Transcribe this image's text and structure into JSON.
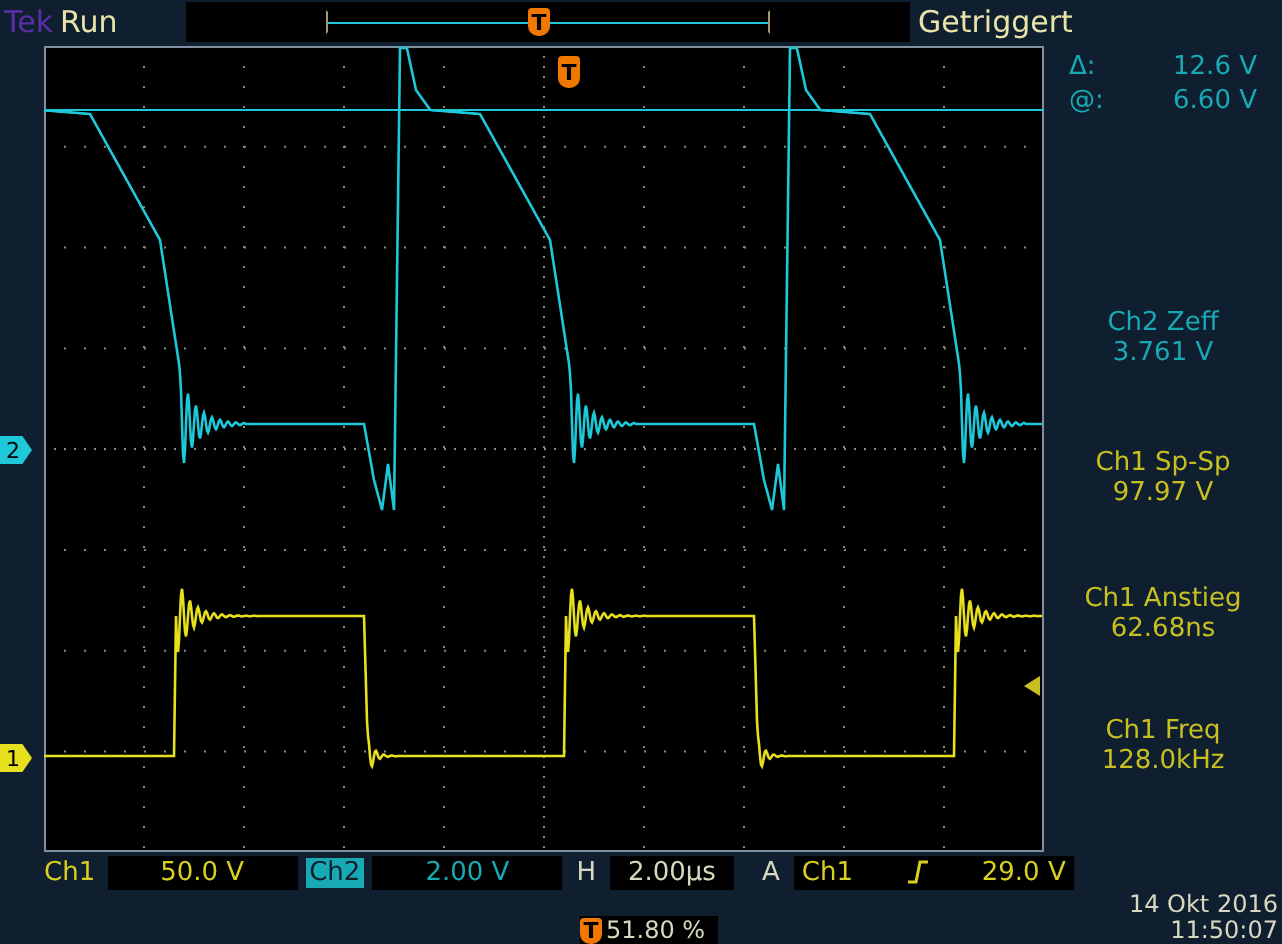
{
  "header": {
    "brand": "Tek",
    "acquisition": "Run",
    "trigger_status": "Getriggert",
    "trigger_position_marker": "T"
  },
  "cursor_readouts": [
    {
      "label": "Δ:",
      "value": "12.6 V"
    },
    {
      "label": "@:",
      "value": "6.60 V"
    }
  ],
  "display": {
    "trigger_marker": "T",
    "channel_markers": [
      {
        "label": "2",
        "color": "#1ec8d8"
      },
      {
        "label": "1",
        "color": "#e6e01e"
      }
    ]
  },
  "measurements": [
    {
      "name": "Ch2 Zeff",
      "value": "3.761 V",
      "color": "#18aab4"
    },
    {
      "name": "Ch1 Sp-Sp",
      "value": "97.97 V",
      "color": "#c8c020"
    },
    {
      "name": "Ch1 Anstieg",
      "value": "62.68ns",
      "color": "#c8c020"
    },
    {
      "name": "Ch1 Freq",
      "value": "128.0kHz",
      "color": "#c8c020"
    }
  ],
  "channel_settings": [
    {
      "channel": "Ch1",
      "scale": "50.0 V",
      "selected": false,
      "color": "#d8d020"
    },
    {
      "channel": "Ch2",
      "scale": "2.00 V",
      "selected": true,
      "color": "#18aab4"
    }
  ],
  "horizontal": {
    "label": "H",
    "scale": "2.00µs"
  },
  "trigger": {
    "label": "A",
    "source": "Ch1",
    "level": "29.0 V"
  },
  "trigger_position": {
    "marker": "T",
    "value": "51.80 %"
  },
  "date": "14 Okt 2016",
  "time": "11:50:07"
}
